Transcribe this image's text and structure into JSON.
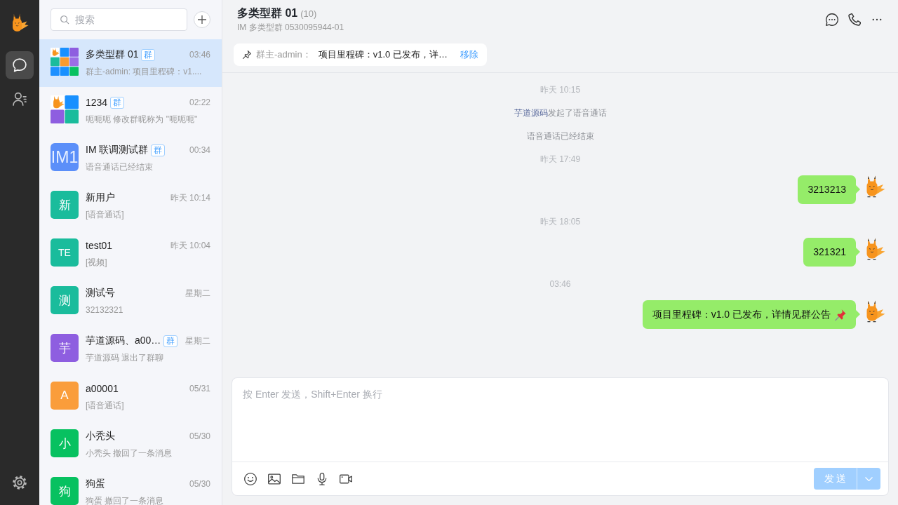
{
  "rail": {
    "items": [
      {
        "kind": "chats",
        "selected": true
      },
      {
        "kind": "contacts",
        "selected": false
      }
    ]
  },
  "search": {
    "placeholder": "搜索"
  },
  "conversations": [
    {
      "name": "多类型群 01",
      "tag": "群",
      "time": "03:46",
      "preview": "群主-admin: 项目里程碑：v1....",
      "avatar": {
        "kind": "grid9"
      },
      "selected": true
    },
    {
      "name": "1234",
      "tag": "群",
      "time": "02:22",
      "preview": "呃呃呃 修改群昵称为 \"呃呃呃\"",
      "avatar": {
        "kind": "grid4"
      },
      "selected": false
    },
    {
      "name": "IM 联调测试群",
      "tag": "群",
      "time": "00:34",
      "preview": "语音通话已经结束",
      "avatar": {
        "kind": "banner",
        "text": "IM1"
      },
      "color": "#5b8ff9",
      "selected": false
    },
    {
      "name": "新用户",
      "time": "昨天 10:14",
      "preview": "[语音通话]",
      "avatar": {
        "kind": "letters",
        "text": "新"
      },
      "color": "#1abc9c",
      "selected": false
    },
    {
      "name": "test01",
      "time": "昨天 10:04",
      "preview": "[视频]",
      "avatar": {
        "kind": "letters",
        "text": "TE"
      },
      "color": "#1abc9c",
      "selected": false
    },
    {
      "name": "测试号",
      "time": "星期二",
      "preview": "32132321",
      "avatar": {
        "kind": "letters",
        "text": "测"
      },
      "color": "#1abc9c",
      "selected": false
    },
    {
      "name": "芋道源码、a00…",
      "tag": "群",
      "time": "星期二",
      "preview": "芋道源码 退出了群聊",
      "avatar": {
        "kind": "letters",
        "text": "芋"
      },
      "color": "#8e5ee0",
      "selected": false
    },
    {
      "name": "a00001",
      "time": "05/31",
      "preview": "[语音通话]",
      "avatar": {
        "kind": "letters",
        "text": "A"
      },
      "color": "#fa9d3b",
      "selected": false
    },
    {
      "name": "小秃头",
      "time": "05/30",
      "preview": "小秃头 撤回了一条消息",
      "avatar": {
        "kind": "letters",
        "text": "小"
      },
      "color": "#07c160",
      "selected": false
    },
    {
      "name": "狗蛋",
      "time": "05/30",
      "preview": "狗蛋 撤回了一条消息",
      "avatar": {
        "kind": "letters",
        "text": "狗"
      },
      "color": "#07c160",
      "selected": false
    }
  ],
  "chat": {
    "title": "多类型群 01",
    "member_count": "(10)",
    "subtitle": "IM 多类型群 0530095944-01",
    "pinned": {
      "sender": "群主-admin：",
      "text": "项目里程碑：v1.0 已发布，详…",
      "action": "移除"
    },
    "messages": [
      {
        "kind": "time",
        "text": "昨天 10:15"
      },
      {
        "kind": "system",
        "actor": "芋道源码",
        "text": "发起了语音通话"
      },
      {
        "kind": "system",
        "text": "语音通话已经结束"
      },
      {
        "kind": "time",
        "text": "昨天 17:49"
      },
      {
        "kind": "mine",
        "text": "3213213",
        "pinned": false
      },
      {
        "kind": "time",
        "text": "昨天 18:05"
      },
      {
        "kind": "mine",
        "text": "321321",
        "pinned": false
      },
      {
        "kind": "time",
        "text": "03:46"
      },
      {
        "kind": "mine",
        "text": "项目里程碑：v1.0 已发布，详情见群公告",
        "pinned": true
      }
    ]
  },
  "composer": {
    "placeholder": "按 Enter 发送，Shift+Enter 换行",
    "send_label": "发 送",
    "send_disabled": true
  }
}
